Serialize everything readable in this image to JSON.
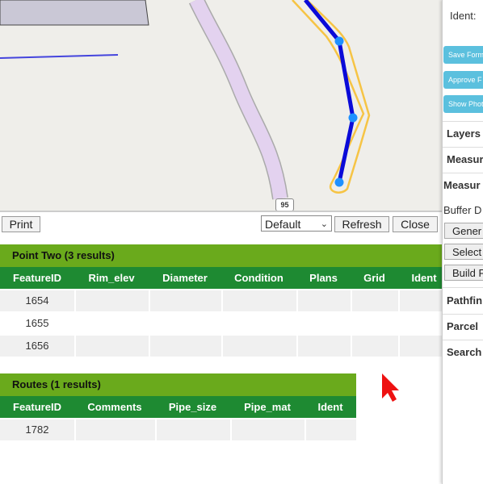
{
  "map": {
    "route_shield": "95"
  },
  "toolbar": {
    "print_label": "Print",
    "select_value": "Default",
    "refresh_label": "Refresh",
    "close_label": "Close"
  },
  "tables": {
    "point_two": {
      "title": "Point Two (3 results)",
      "columns": [
        "FeatureID",
        "Rim_elev",
        "Diameter",
        "Condition",
        "Plans",
        "Grid",
        "Ident"
      ],
      "rows": [
        [
          "1654"
        ],
        [
          "1655"
        ],
        [
          "1656"
        ]
      ]
    },
    "routes": {
      "title": "Routes (1 results)",
      "columns": [
        "FeatureID",
        "Comments",
        "Pipe_size",
        "Pipe_mat",
        "Ident"
      ],
      "rows": [
        [
          "1782"
        ]
      ]
    }
  },
  "sidebar": {
    "ident_label": "Ident:",
    "buttons": [
      "Save Form",
      "Approve F",
      "Show Photo"
    ],
    "sections": [
      "Layers",
      "Measur",
      "Measur",
      "Buffer D",
      "Pathfin",
      "Parcel",
      "Search"
    ],
    "tool_buttons": [
      "Gener",
      "Select",
      "Build F"
    ]
  },
  "colors": {
    "header_green": "#1e8a32",
    "title_green": "#6aaa1c",
    "route_blue": "#0a0ad8",
    "sidebar_button": "#5bc0de",
    "cursor": "#ee1111"
  }
}
